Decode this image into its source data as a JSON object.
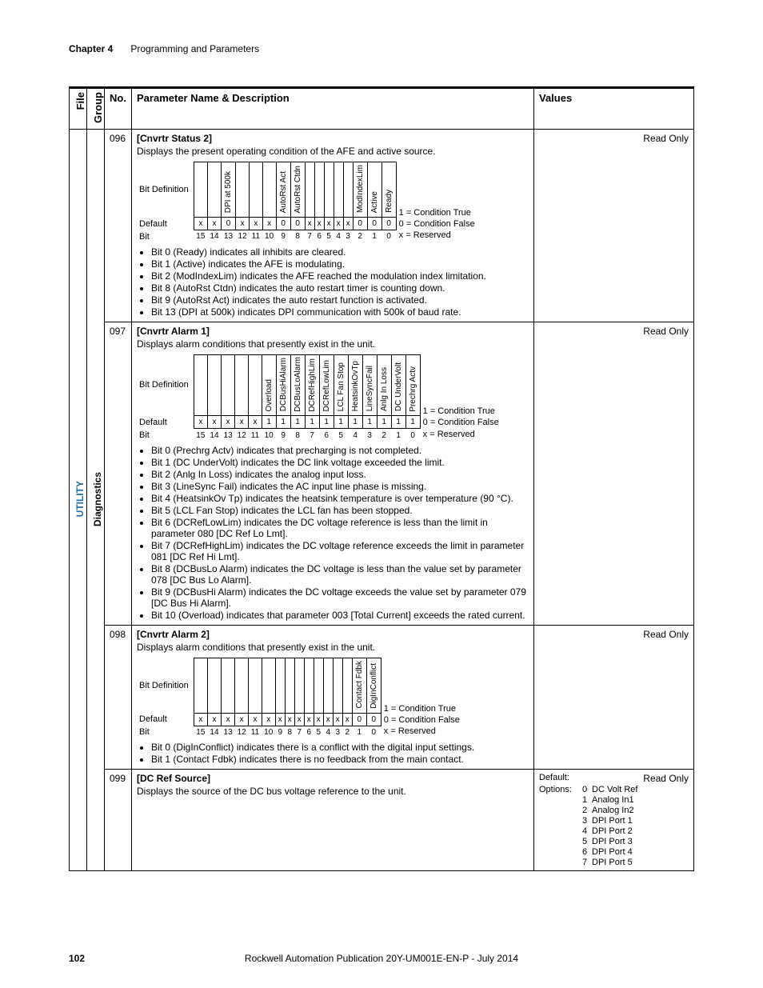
{
  "running_head": {
    "chapter_label": "Chapter 4",
    "chapter_title": "Programming and Parameters"
  },
  "footer": {
    "page": "102",
    "pub": "Rockwell Automation Publication 20Y-UM001E-EN-P - July 2014"
  },
  "headers": {
    "file": "File",
    "group": "Group",
    "no": "No.",
    "pnd": "Parameter Name & Description",
    "values": "Values"
  },
  "side": {
    "file": "UTILITY",
    "group": "Diagnostics"
  },
  "common": {
    "bitdef": "Bit Definition",
    "default": "Default",
    "bit": "Bit",
    "legend1": "1 = Condition True",
    "legend0": "0 = Condition False",
    "legendx": "x = Reserved",
    "bit_numbers": [
      "15",
      "14",
      "13",
      "12",
      "11",
      "10",
      "9",
      "8",
      "7",
      "6",
      "5",
      "4",
      "3",
      "2",
      "1",
      "0"
    ]
  },
  "p096": {
    "no": "096",
    "name": "[Cnvrtr Status 2]",
    "readonly": "Read Only",
    "desc": "Displays the present operating condition of the AFE and active source.",
    "bitlabels": [
      "",
      "",
      "DPI at 500k",
      "",
      "",
      "",
      "AutoRst Act",
      "AutoRst Ctdn",
      "",
      "",
      "",
      "",
      "",
      "ModIndexLim",
      "Active",
      "Ready"
    ],
    "defaults": [
      "x",
      "x",
      "0",
      "x",
      "x",
      "x",
      "0",
      "0",
      "x",
      "x",
      "x",
      "x",
      "x",
      "0",
      "0",
      "0"
    ],
    "bullets": [
      "Bit 0 (Ready) indicates all inhibits are cleared.",
      "Bit 1 (Active) indicates the AFE is modulating.",
      "Bit 2 (ModIndexLim) indicates the AFE reached the modulation index limitation.",
      "Bit 8 (AutoRst Ctdn) indicates the auto restart timer is counting down.",
      "Bit 9 (AutoRst Act) indicates the auto restart function is activated.",
      "Bit 13 (DPI at 500k) indicates DPI communication with 500k of baud rate."
    ]
  },
  "p097": {
    "no": "097",
    "name": "[Cnvrtr Alarm 1]",
    "readonly": "Read Only",
    "desc": "Displays alarm conditions that presently exist in the unit.",
    "bitlabels": [
      "",
      "",
      "",
      "",
      "",
      "Overload",
      "DCBusHiAlarm",
      "DCBusLoAlarm",
      "DCRefHighLim",
      "DCRefLowLim",
      "LCL Fan Stop",
      "HeatsinkOvTp",
      "LineSyncFail",
      "Anlg In Loss",
      "DC UnderVolt",
      "Prechrg Actv"
    ],
    "defaults": [
      "x",
      "x",
      "x",
      "x",
      "x",
      "1",
      "1",
      "1",
      "1",
      "1",
      "1",
      "1",
      "1",
      "1",
      "1",
      "1"
    ],
    "bullets": [
      "Bit 0 (Prechrg Actv) indicates that precharging is not completed.",
      "Bit 1 (DC UnderVolt) indicates the DC link voltage exceeded the limit.",
      "Bit 2 (Anlg In Loss) indicates the analog input loss.",
      "Bit 3 (LineSync Fail) indicates the AC input line phase is missing.",
      "Bit 4 (HeatsinkOv Tp) indicates the heatsink temperature is over temperature (90 °C).",
      "Bit 5 (LCL Fan Stop) indicates the LCL fan has been stopped.",
      "Bit 6 (DCRefLowLim) indicates the DC voltage reference is less than the limit in parameter 080 [DC Ref Lo Lmt].",
      "Bit 7 (DCRefHighLim) indicates the DC voltage reference exceeds the limit in parameter 081 [DC Ref Hi Lmt].",
      "Bit 8 (DCBusLo Alarm) indicates the DC voltage is less than the value set by parameter 078 [DC Bus Lo Alarm].",
      "Bit 9 (DCBusHi Alarm) indicates the DC voltage exceeds the value set by parameter 079 [DC Bus Hi Alarm].",
      "Bit 10 (Overload) indicates that parameter 003 [Total Current] exceeds the rated current."
    ]
  },
  "p098": {
    "no": "098",
    "name": "[Cnvrtr Alarm 2]",
    "readonly": "Read Only",
    "desc": "Displays alarm conditions that presently exist in the unit.",
    "bitlabels": [
      "",
      "",
      "",
      "",
      "",
      "",
      "",
      "",
      "",
      "",
      "",
      "",
      "",
      "",
      "Contact Fdbk",
      "DigInConflict"
    ],
    "defaults": [
      "x",
      "x",
      "x",
      "x",
      "x",
      "x",
      "x",
      "x",
      "x",
      "x",
      "x",
      "x",
      "x",
      "x",
      "0",
      "0"
    ],
    "bullets": [
      "Bit 0 (DigInConflict) indicates there is a conflict with the digital input settings.",
      "Bit 1 (Contact Fdbk) indicates there is no feedback from the main contact."
    ]
  },
  "p099": {
    "no": "099",
    "name": "[DC Ref Source]",
    "readonly": "Read Only",
    "desc": "Displays the source of the DC bus voltage reference to the unit.",
    "values": {
      "default_label": "Default:",
      "options_label": "Options:",
      "options": [
        {
          "n": "0",
          "t": "DC Volt Ref"
        },
        {
          "n": "1",
          "t": "Analog In1"
        },
        {
          "n": "2",
          "t": "Analog In2"
        },
        {
          "n": "3",
          "t": "DPI Port 1"
        },
        {
          "n": "4",
          "t": "DPI Port 2"
        },
        {
          "n": "5",
          "t": "DPI Port 3"
        },
        {
          "n": "6",
          "t": "DPI Port 4"
        },
        {
          "n": "7",
          "t": "DPI Port 5"
        }
      ]
    }
  }
}
